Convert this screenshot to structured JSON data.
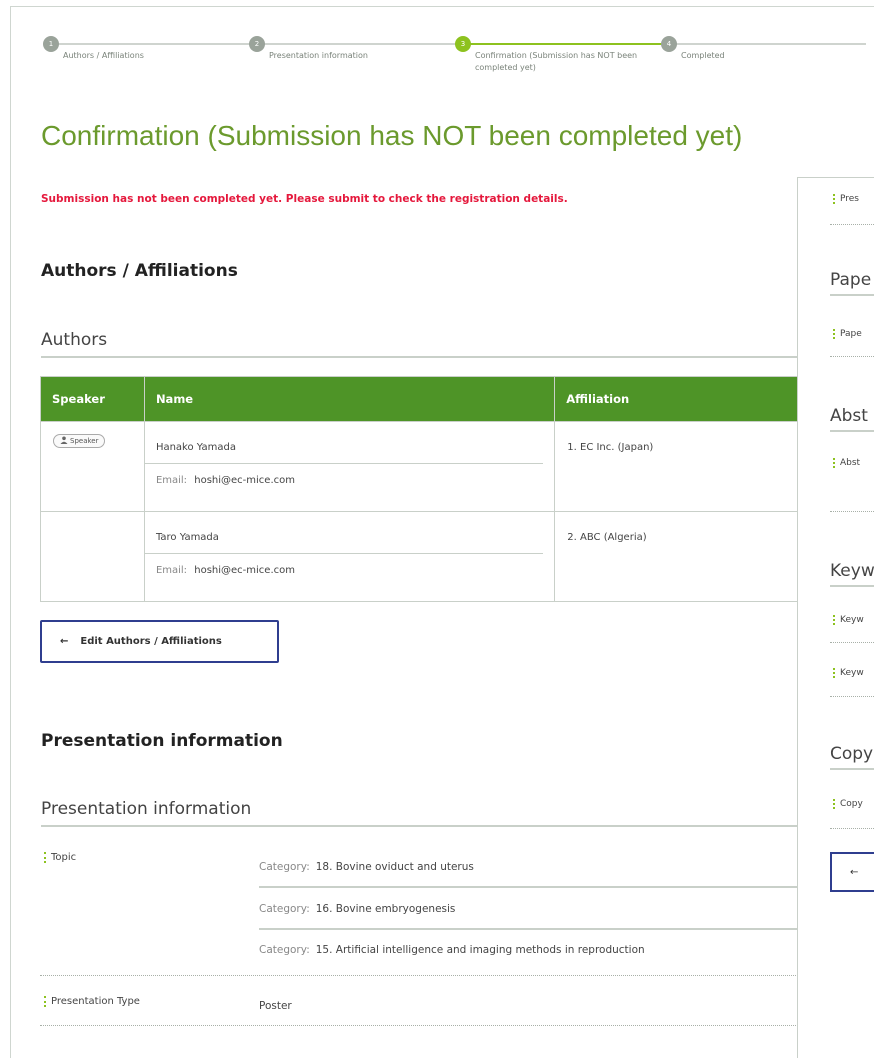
{
  "stepper": {
    "steps": [
      {
        "num": "1",
        "label": "Authors / Affiliations"
      },
      {
        "num": "2",
        "label": "Presentation information"
      },
      {
        "num": "3",
        "label": "Confirmation (Submission has NOT been completed yet)"
      },
      {
        "num": "4",
        "label": "Completed"
      }
    ]
  },
  "page": {
    "title": "Confirmation (Submission has NOT been completed yet)",
    "warning": "Submission has not been completed yet. Please submit to check the registration details."
  },
  "authors_section": {
    "title": "Authors / Affiliations",
    "subtitle": "Authors",
    "headers": {
      "speaker": "Speaker",
      "name": "Name",
      "affiliation": "Affiliation"
    },
    "speaker_badge": "Speaker",
    "email_label": "Email:",
    "rows": [
      {
        "name": "Hanako Yamada",
        "email": "hoshi@ec-mice.com",
        "affiliation": "1. EC Inc. (Japan)"
      },
      {
        "name": "Taro Yamada",
        "email": "hoshi@ec-mice.com",
        "affiliation": "2. ABC (Algeria)"
      }
    ],
    "edit_button": "Edit Authors / Affiliations"
  },
  "presentation_section": {
    "title": "Presentation information",
    "subtitle": "Presentation information",
    "topic_label": "Topic",
    "category_label": "Category:",
    "categories": [
      "18. Bovine oviduct and uterus",
      "16. Bovine embryogenesis",
      "15. Artificial intelligence and imaging methods in reproduction"
    ],
    "type_label": "Presentation Type",
    "type_value": "Poster"
  },
  "right_panel": {
    "item1": "Pres",
    "head_paper": "Pape",
    "item_paper": "Pape",
    "head_abstract": "Abst",
    "item_abstract": "Abst",
    "head_keywords": "Keyw",
    "item_kw1": "Keyw",
    "item_kw2": "Keyw",
    "head_copy": "Copy",
    "item_copy": "Copy"
  },
  "colors": {
    "accent": "#6b9a2d",
    "table_header": "#4e9427",
    "warning": "#e5183c",
    "button_border": "#2f3e8f"
  }
}
